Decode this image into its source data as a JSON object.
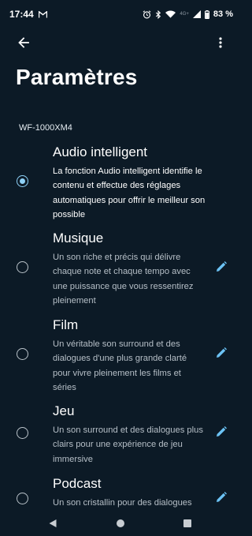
{
  "status": {
    "time": "17:44",
    "notification_icon": "gmail-icon",
    "battery": "83 %",
    "network": "4G+"
  },
  "page": {
    "title": "Paramètres"
  },
  "device": {
    "name": "WF-1000XM4"
  },
  "options": [
    {
      "title": "Audio intelligent",
      "description": "La fonction Audio intelligent identifie le contenu et effectue des réglages automatiques pour offrir le meilleur son possible",
      "selected": true
    },
    {
      "title": "Musique",
      "description": "Un son riche et précis qui délivre chaque note et chaque tempo avec une puissance que vous ressentirez pleinement",
      "selected": false
    },
    {
      "title": "Film",
      "description": "Un véritable son surround et des dialogues d'une plus grande clarté pour vivre pleinement les films et séries",
      "selected": false
    },
    {
      "title": "Jeu",
      "description": "Un son surround et des dialogues plus clairs pour une expérience de jeu immersive",
      "selected": false
    },
    {
      "title": "Podcast",
      "description": "Un son cristallin pour des dialogues",
      "selected": false
    }
  ],
  "colors": {
    "background": "#0c1a26",
    "accent": "#8fd1f7",
    "edit_icon": "#6cc3f5"
  }
}
